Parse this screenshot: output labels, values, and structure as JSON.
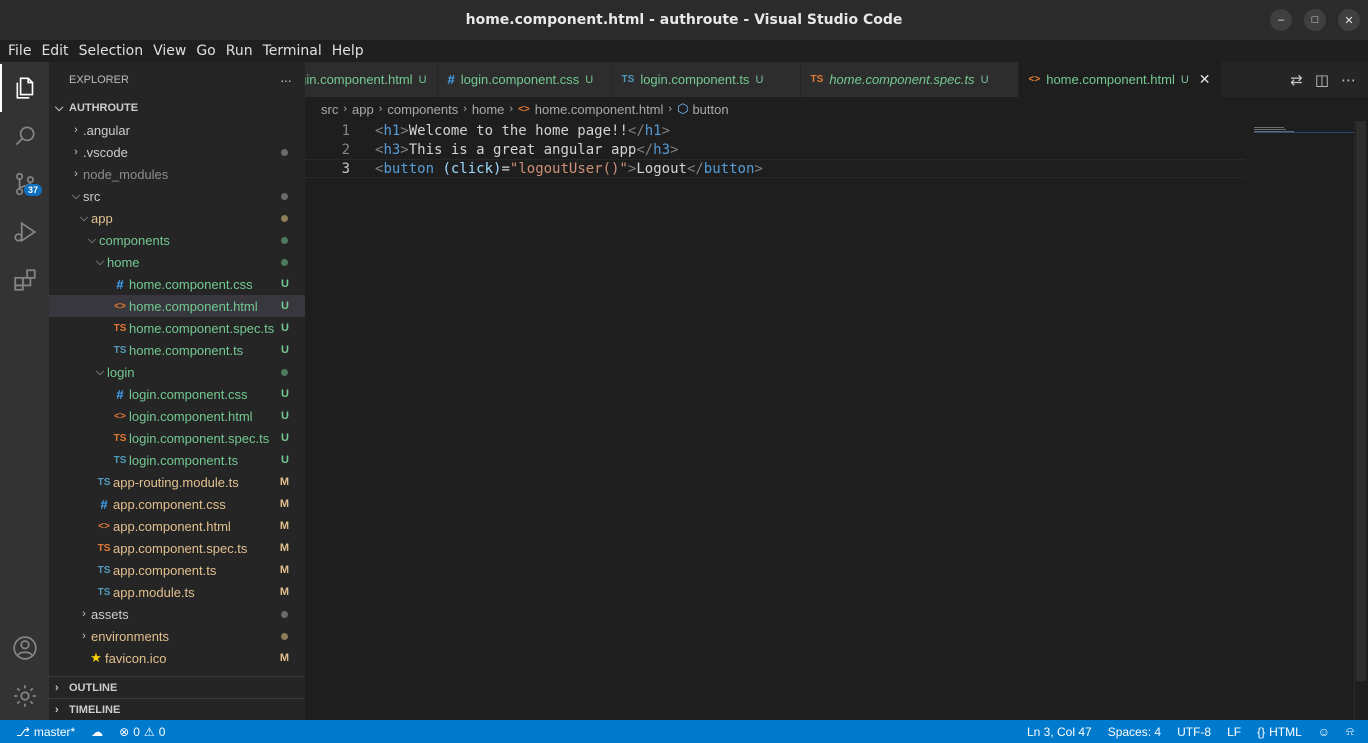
{
  "window": {
    "title": "home.component.html - authroute - Visual Studio Code",
    "controls": [
      "minimize-icon",
      "maximize-icon",
      "close-icon"
    ]
  },
  "menu": {
    "items": [
      {
        "label": "File"
      },
      {
        "label": "Edit"
      },
      {
        "label": "Selection"
      },
      {
        "label": "View"
      },
      {
        "label": "Go"
      },
      {
        "label": "Run"
      },
      {
        "label": "Terminal"
      },
      {
        "label": "Help"
      }
    ]
  },
  "activity": {
    "items": [
      "files-icon",
      "search-icon",
      "source-control-icon",
      "run-debug-icon",
      "extensions-icon"
    ],
    "scm_badge": "37",
    "bottom": [
      "account-icon",
      "settings-gear-icon"
    ]
  },
  "explorer": {
    "header": "EXPLORER",
    "more": "···",
    "root": "AUTHROUTE",
    "tree": [
      {
        "label": ".angular",
        "kind": "folder",
        "open": false,
        "indent": 0,
        "status": ""
      },
      {
        "label": ".vscode",
        "kind": "folder",
        "open": false,
        "indent": 0,
        "status": "dot-gray"
      },
      {
        "label": "node_modules",
        "kind": "folder",
        "open": false,
        "indent": 0,
        "status": "",
        "dim": true
      },
      {
        "label": "src",
        "kind": "folder",
        "open": true,
        "indent": 0,
        "status": "dot-gray"
      },
      {
        "label": "app",
        "kind": "folder",
        "open": true,
        "indent": 1,
        "status": "dot-mod"
      },
      {
        "label": "components",
        "kind": "folder",
        "open": true,
        "indent": 2,
        "status": "dot-green"
      },
      {
        "label": "home",
        "kind": "folder",
        "open": true,
        "indent": 3,
        "status": "dot-green"
      },
      {
        "label": "home.component.css",
        "kind": "css",
        "indent": 4,
        "status": "U"
      },
      {
        "label": "home.component.html",
        "kind": "html",
        "indent": 4,
        "status": "U",
        "selected": true
      },
      {
        "label": "home.component.spec.ts",
        "kind": "spec",
        "indent": 4,
        "status": "U"
      },
      {
        "label": "home.component.ts",
        "kind": "ts",
        "indent": 4,
        "status": "U"
      },
      {
        "label": "login",
        "kind": "folder",
        "open": true,
        "indent": 3,
        "status": "dot-green"
      },
      {
        "label": "login.component.css",
        "kind": "css",
        "indent": 4,
        "status": "U"
      },
      {
        "label": "login.component.html",
        "kind": "html",
        "indent": 4,
        "status": "U"
      },
      {
        "label": "login.component.spec.ts",
        "kind": "spec",
        "indent": 4,
        "status": "U"
      },
      {
        "label": "login.component.ts",
        "kind": "ts",
        "indent": 4,
        "status": "U"
      },
      {
        "label": "app-routing.module.ts",
        "kind": "ts",
        "indent": 2,
        "status": "M"
      },
      {
        "label": "app.component.css",
        "kind": "css",
        "indent": 2,
        "status": "M"
      },
      {
        "label": "app.component.html",
        "kind": "html",
        "indent": 2,
        "status": "M"
      },
      {
        "label": "app.component.spec.ts",
        "kind": "spec",
        "indent": 2,
        "status": "M"
      },
      {
        "label": "app.component.ts",
        "kind": "ts",
        "indent": 2,
        "status": "M"
      },
      {
        "label": "app.module.ts",
        "kind": "ts",
        "indent": 2,
        "status": "M"
      },
      {
        "label": "assets",
        "kind": "folder",
        "open": false,
        "indent": 1,
        "status": "dot-gray"
      },
      {
        "label": "environments",
        "kind": "folder",
        "open": false,
        "indent": 1,
        "status": "dot-mod"
      },
      {
        "label": "favicon.ico",
        "kind": "star",
        "indent": 1,
        "status": "M"
      }
    ],
    "outline": "OUTLINE",
    "timeline": "TIMELINE"
  },
  "tabs": [
    {
      "label": "login.component.html",
      "kind": "html",
      "status": "U",
      "clipped": true
    },
    {
      "label": "login.component.css",
      "kind": "css",
      "status": "U"
    },
    {
      "label": "login.component.ts",
      "kind": "ts",
      "status": "U"
    },
    {
      "label": "home.component.spec.ts",
      "kind": "spec",
      "status": "U",
      "italic": true
    },
    {
      "label": "home.component.html",
      "kind": "html",
      "status": "U",
      "active": true
    }
  ],
  "breadcrumb": [
    "src",
    "app",
    "components",
    "home",
    "home.component.html",
    "button"
  ],
  "editor": {
    "lines": [
      {
        "num": "1",
        "tokens": [
          [
            "punc",
            "<"
          ],
          [
            "tag",
            "h1"
          ],
          [
            "punc",
            ">"
          ],
          [
            "txt",
            "Welcome to the home page!!"
          ],
          [
            "punc",
            "</"
          ],
          [
            "tag",
            "h1"
          ],
          [
            "punc",
            ">"
          ]
        ]
      },
      {
        "num": "2",
        "tokens": [
          [
            "punc",
            "<"
          ],
          [
            "tag",
            "h3"
          ],
          [
            "punc",
            ">"
          ],
          [
            "txt",
            "This is a great angular app"
          ],
          [
            "punc",
            "</"
          ],
          [
            "tag",
            "h3"
          ],
          [
            "punc",
            ">"
          ]
        ]
      },
      {
        "num": "3",
        "tokens": [
          [
            "punc",
            "<"
          ],
          [
            "tag",
            "button"
          ],
          [
            "txt",
            " "
          ],
          [
            "attr",
            "(click)"
          ],
          [
            "txt",
            "="
          ],
          [
            "str",
            "\"logoutUser()\""
          ],
          [
            "punc",
            ">"
          ],
          [
            "txt",
            "Logout"
          ],
          [
            "punc",
            "</"
          ],
          [
            "tag",
            "button"
          ],
          [
            "punc",
            ">"
          ]
        ]
      }
    ],
    "current_line": "3"
  },
  "status": {
    "branch": "master*",
    "errors": "0",
    "warnings": "0",
    "position": "Ln 3, Col 47",
    "spaces": "Spaces: 4",
    "encoding": "UTF-8",
    "eol": "LF",
    "language": "HTML"
  }
}
